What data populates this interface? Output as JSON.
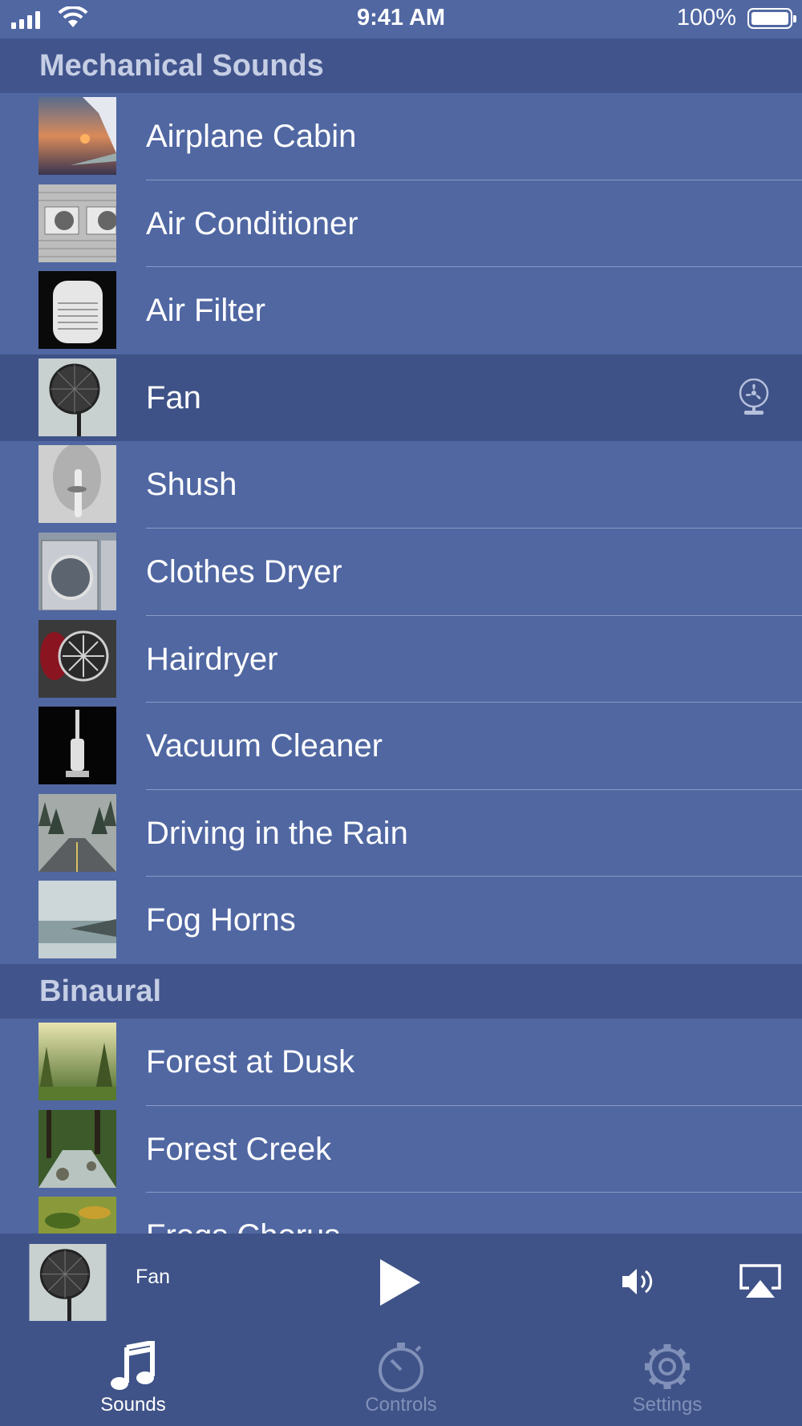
{
  "status_bar": {
    "time": "9:41 AM",
    "battery": "100%"
  },
  "sections": [
    {
      "title": "Mechanical Sounds",
      "items": [
        {
          "label": "Airplane Cabin"
        },
        {
          "label": "Air Conditioner"
        },
        {
          "label": "Air Filter"
        },
        {
          "label": "Fan",
          "selected": true
        },
        {
          "label": "Shush"
        },
        {
          "label": "Clothes Dryer"
        },
        {
          "label": "Hairdryer"
        },
        {
          "label": "Vacuum Cleaner"
        },
        {
          "label": "Driving in the Rain"
        },
        {
          "label": "Fog Horns"
        }
      ]
    },
    {
      "title": "Binaural",
      "items": [
        {
          "label": "Forest at Dusk"
        },
        {
          "label": "Forest Creek"
        },
        {
          "label": "Frogs Chorus"
        }
      ]
    }
  ],
  "player": {
    "title": "Fan"
  },
  "tabs": [
    {
      "label": "Sounds",
      "icon": "music-note-icon",
      "active": true
    },
    {
      "label": "Controls",
      "icon": "stopwatch-icon",
      "active": false
    },
    {
      "label": "Settings",
      "icon": "gear-icon",
      "active": false
    }
  ],
  "colors": {
    "background": "#5067a2",
    "section_header": "#41548c",
    "selected_row": "#3e5287",
    "player_bar": "#3f5388"
  }
}
